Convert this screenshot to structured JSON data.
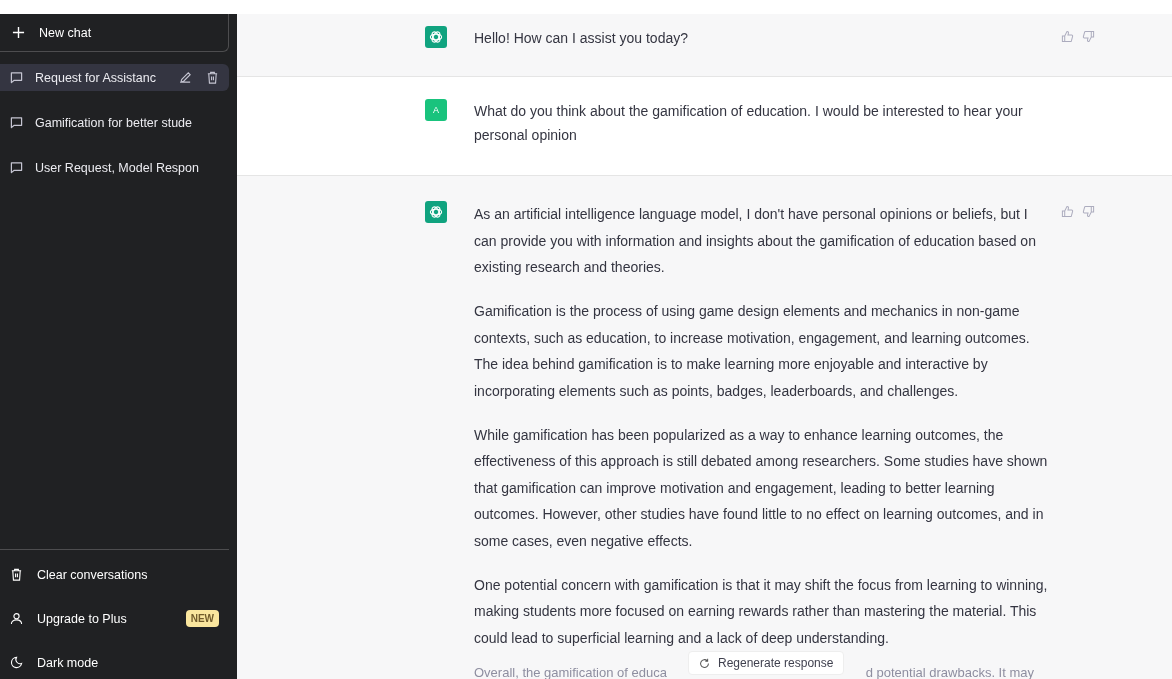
{
  "sidebar": {
    "new_chat": "New chat",
    "conversations": [
      {
        "title": "Request for Assistanc",
        "selected": true
      },
      {
        "title": "Gamification for better stude",
        "selected": false
      },
      {
        "title": "User Request, Model Respon",
        "selected": false
      }
    ],
    "bottom_items": [
      {
        "kind": "clear",
        "label": "Clear conversations"
      },
      {
        "kind": "upgrade",
        "label": "Upgrade to Plus",
        "badge": "NEW"
      },
      {
        "kind": "dark",
        "label": "Dark mode"
      }
    ]
  },
  "messages": [
    {
      "kind": "assistant",
      "paragraphs": [
        "Hello! How can I assist you today?"
      ]
    },
    {
      "kind": "user",
      "avatar": "A",
      "paragraphs": [
        "What do you think about the gamification of education. I would be interested to hear your personal opinion"
      ]
    },
    {
      "kind": "assistant",
      "paragraphs": [
        "As an artificial intelligence language model, I don't have personal opinions or beliefs, but I can provide you with information and insights about the gamification of education based on existing research and theories.",
        "Gamification is the process of using game design elements and mechanics in non-game contexts, such as education, to increase motivation, engagement, and learning outcomes. The idea behind gamification is to make learning more enjoyable and interactive by incorporating elements such as points, badges, leaderboards, and challenges.",
        "While gamification has been popularized as a way to enhance learning outcomes, the effectiveness of this approach is still debated among researchers. Some studies have shown that gamification can improve motivation and engagement, leading to better learning outcomes. However, other studies have found little to no effect on learning outcomes, and in some cases, even negative effects.",
        "One potential concern with gamification is that it may shift the focus from learning to winning, making students more focused on earning rewards rather than mastering the material. This could lead to superficial learning and a lack of deep understanding."
      ],
      "cut_line": [
        "Overall, the gamification of educa",
        "d potential drawbacks. It may"
      ]
    }
  ],
  "regenerate_button": "Regenerate response"
}
